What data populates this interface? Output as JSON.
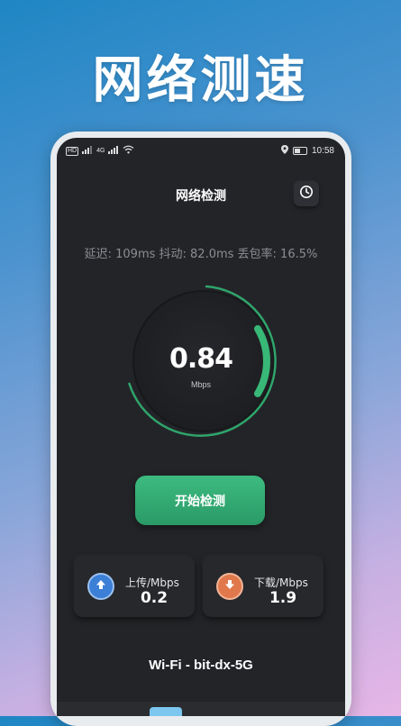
{
  "banner": {
    "title": "网络测速"
  },
  "status_bar": {
    "time": "10:58",
    "network_left": "HD",
    "signal_label": "4G"
  },
  "header": {
    "title": "网络检测",
    "history_icon": "clock-icon"
  },
  "stats": {
    "text": "延迟: 109ms  抖动: 82.0ms  丢包率: 16.5%"
  },
  "gauge": {
    "value": "0.84",
    "unit": "Mbps",
    "progress": 0.84,
    "accent": "#2fa56b"
  },
  "start_button": {
    "label": "开始检测"
  },
  "upload": {
    "label": "上传/Mbps",
    "value": "0.2",
    "icon": "upload-arrow-icon",
    "color": "#3b7fd6"
  },
  "download": {
    "label": "下载/Mbps",
    "value": "1.9",
    "icon": "download-arrow-icon",
    "color": "#e0784c"
  },
  "wifi": {
    "name": "Wi-Fi - bit-dx-5G"
  }
}
